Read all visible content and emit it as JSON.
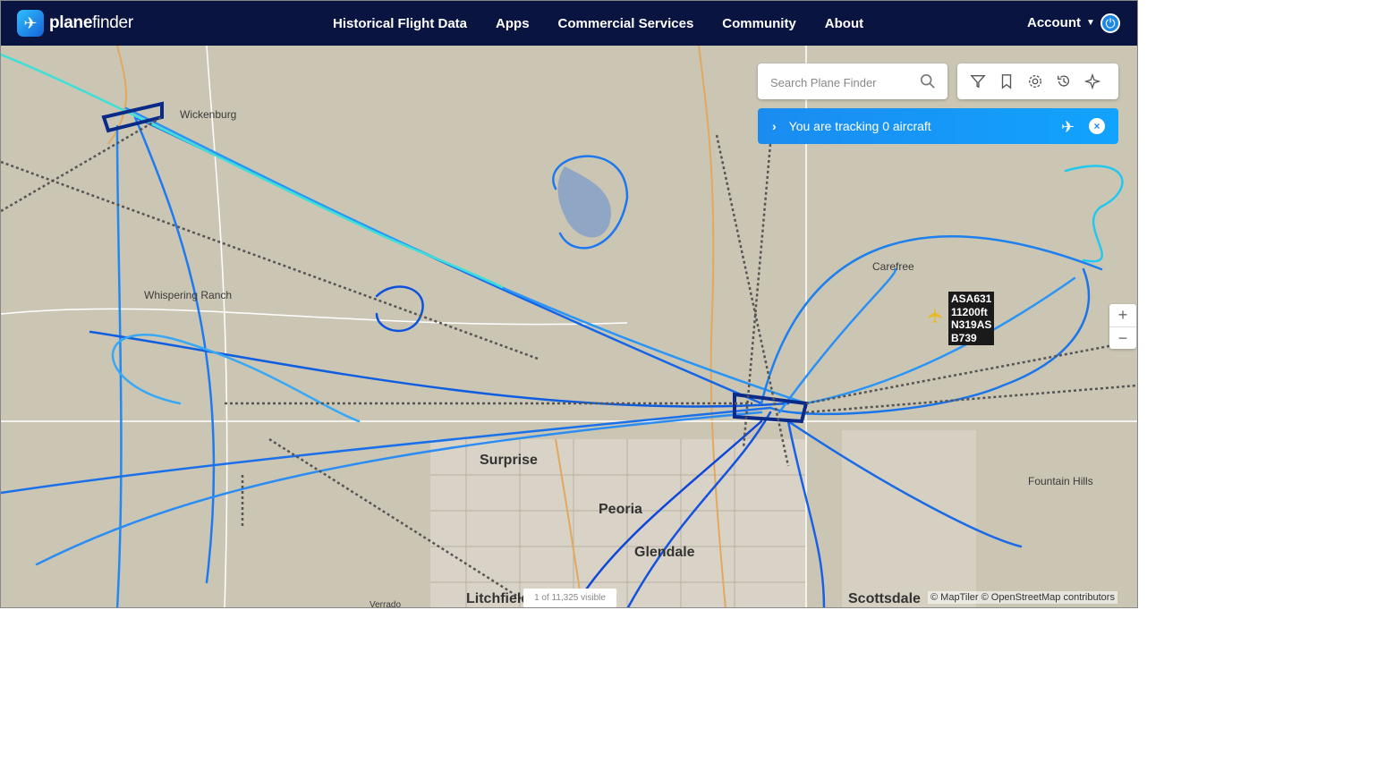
{
  "brand": {
    "name_bold": "plane",
    "name_light": "finder",
    "logo_icon": "plane-logo-icon"
  },
  "nav": {
    "items": [
      {
        "label": "Historical Flight Data"
      },
      {
        "label": "Apps"
      },
      {
        "label": "Commercial Services"
      },
      {
        "label": "Community"
      },
      {
        "label": "About"
      }
    ],
    "account_label": "Account"
  },
  "search": {
    "placeholder": "Search Plane Finder",
    "value": ""
  },
  "toolbar": {
    "icons": [
      "filter-icon",
      "bookmark-icon",
      "gear-icon",
      "history-icon",
      "plane-mode-icon"
    ]
  },
  "tracking": {
    "text": "You are tracking 0 aircraft"
  },
  "map": {
    "places": [
      {
        "text": "Wickenburg"
      },
      {
        "text": "Whispering Ranch"
      },
      {
        "text": "Carefree"
      },
      {
        "text": "Surprise"
      },
      {
        "text": "Peoria"
      },
      {
        "text": "Glendale"
      },
      {
        "text": "Litchfield"
      },
      {
        "text": "Scottsdale"
      },
      {
        "text": "Fountain Hills"
      },
      {
        "text": "Verrado"
      }
    ],
    "attribution": "© MapTiler © OpenStreetMap contributors",
    "visible_count": "1 of 11,325 visible",
    "zoom_in": "+",
    "zoom_out": "−"
  },
  "aircraft": {
    "callsign": "ASA631",
    "altitude": "11200ft",
    "registration": "N319AS",
    "type": "B739",
    "color": "#e8b923"
  },
  "colors": {
    "topbar": "#0a1440",
    "accent": "#1a8cf0",
    "map": "#cbc6b4"
  }
}
